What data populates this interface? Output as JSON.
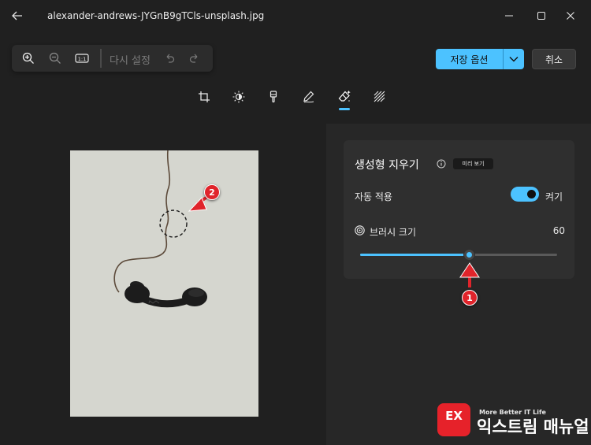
{
  "window": {
    "title": "alexander-andrews-JYGnB9gTCls-unsplash.jpg",
    "controls": [
      "minimize",
      "maximize",
      "close"
    ]
  },
  "toolbar": {
    "zoom_in": "zoom-in-icon",
    "zoom_out": "zoom-out-icon",
    "actual_size_label": "1:1",
    "reset_label": "다시 설정",
    "undo": "undo-icon",
    "redo": "redo-icon"
  },
  "header_actions": {
    "save_label": "저장 옵션",
    "cancel_label": "취소"
  },
  "edit_tabs": [
    {
      "name": "crop",
      "active": false
    },
    {
      "name": "adjust",
      "active": false
    },
    {
      "name": "filter",
      "active": false
    },
    {
      "name": "markup",
      "active": false
    },
    {
      "name": "generative-erase",
      "active": true
    },
    {
      "name": "background-blur",
      "active": false
    }
  ],
  "panel": {
    "title": "생성형 지우기",
    "preview_badge": "미리 보기",
    "auto_apply_label": "자동 적용",
    "auto_apply_state": "켜기",
    "auto_apply_on": true,
    "brush_label": "브러시 크기",
    "brush_value": "60",
    "brush_level": 0.55
  },
  "annotations": [
    {
      "label": "1",
      "color": "#e0242b"
    },
    {
      "label": "2",
      "color": "#e0242b"
    }
  ],
  "watermark": {
    "logo_text": "EX",
    "tagline": "More Better IT Life",
    "name": "익스트림 매뉴얼"
  },
  "colors": {
    "accent": "#4cc2ff",
    "background": "#202020",
    "panel": "#2f2f2f",
    "annotation": "#e0242b"
  }
}
